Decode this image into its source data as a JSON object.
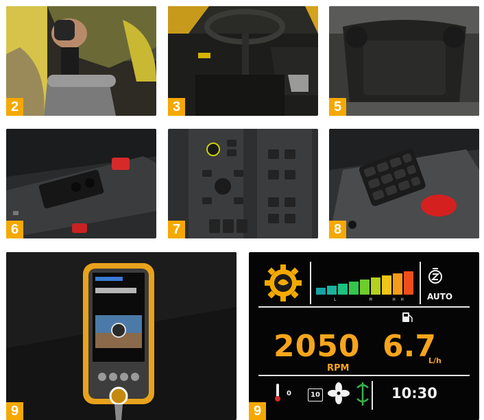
{
  "tiles": [
    {
      "badge": "2"
    },
    {
      "badge": "3"
    },
    {
      "badge": "5"
    },
    {
      "badge": "6"
    },
    {
      "badge": "7"
    },
    {
      "badge": "8"
    },
    {
      "badge": "9"
    },
    {
      "badge": "9"
    }
  ],
  "display": {
    "rpm_value": "2050",
    "rpm_unit": "RPM",
    "fuel_value": "6.7",
    "fuel_unit": "L/h",
    "mode_label": "AUTO",
    "clock": "10:30",
    "gear_value": "10",
    "temp_value": "0",
    "level_marks": [
      "L",
      "M",
      "H",
      "H"
    ],
    "bar_colors": [
      "#16a3a8",
      "#1bb29c",
      "#1cc07f",
      "#34c64a",
      "#6fcc2b",
      "#b4d11e",
      "#f0c419",
      "#f59a1a",
      "#ef4e1b"
    ]
  },
  "colors": {
    "badge": "#f5a800",
    "display_text": "#f6a51c"
  },
  "icons": [
    "engine-gear-icon",
    "load-bar-icon",
    "auto-idle-icon",
    "fuel-pump-icon",
    "thermometer-icon",
    "fan-icon",
    "hydraulic-icon"
  ]
}
